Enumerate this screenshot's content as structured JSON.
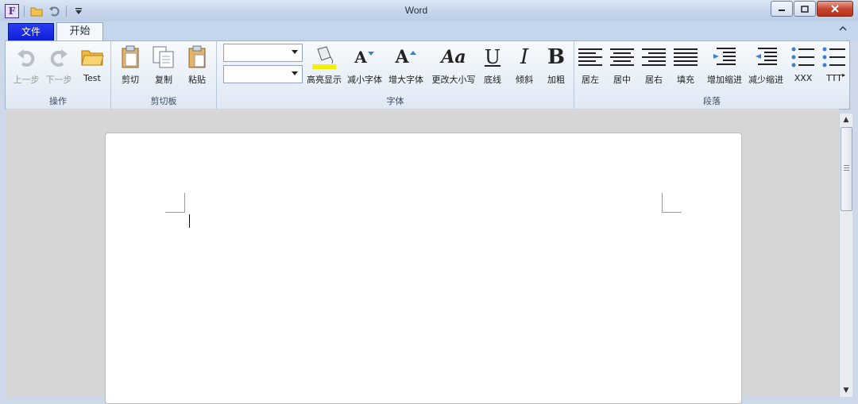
{
  "window": {
    "title": "Word",
    "app_icon_letter": "F"
  },
  "tabs": {
    "file": "文件",
    "home": "开始"
  },
  "ribbon": {
    "groups": {
      "operation": "操作",
      "clipboard": "剪切板",
      "font": "字体",
      "paragraph": "段落"
    },
    "buttons": {
      "undo": "上一步",
      "redo": "下一步",
      "test": "Test",
      "cut": "剪切",
      "copy": "复制",
      "paste": "粘贴",
      "highlight": "高亮显示",
      "shrink_font": "减小字体",
      "grow_font": "增大字体",
      "change_case": "更改大小写",
      "underline": "底线",
      "italic": "倾斜",
      "bold": "加粗",
      "align_left": "居左",
      "align_center": "居中",
      "align_right": "居右",
      "justify": "填充",
      "increase_indent": "增加缩进",
      "decrease_indent": "减少缩进",
      "bullets_xxx": "XXX",
      "bullets_ttt": "TTT"
    },
    "glyphs": {
      "shrink": "A",
      "grow": "A",
      "case": "Aa",
      "underline": "U",
      "italic": "I",
      "bold": "B"
    },
    "font_name_value": "",
    "font_size_value": ""
  },
  "colors": {
    "file_tab": "#0d1fd6",
    "highlight_bar": "#f2f200",
    "close_button": "#c7462f"
  }
}
